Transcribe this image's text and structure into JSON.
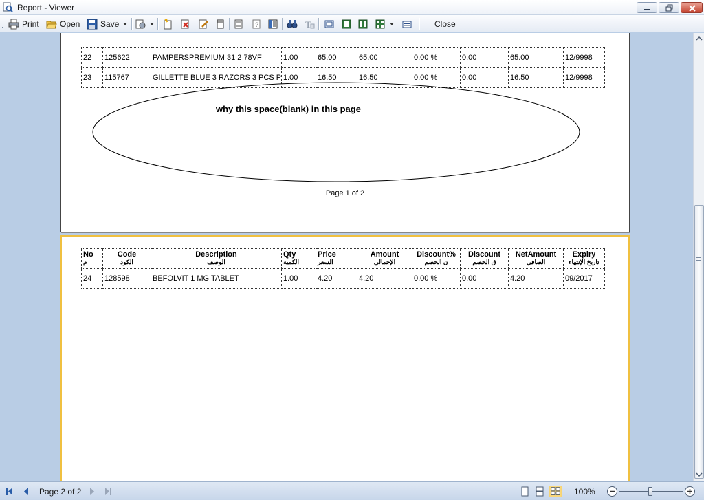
{
  "window": {
    "title": "Report - Viewer"
  },
  "toolbar": {
    "print_label": "Print",
    "open_label": "Open",
    "save_label": "Save",
    "close_label": "Close"
  },
  "columns": [
    {
      "en": "No",
      "ar": "م"
    },
    {
      "en": "Code",
      "ar": "الكود"
    },
    {
      "en": "Description",
      "ar": "الوصف"
    },
    {
      "en": "Qty",
      "ar": "الكمية"
    },
    {
      "en": "Price",
      "ar": "السعر"
    },
    {
      "en": "Amount",
      "ar": "الإجمالي"
    },
    {
      "en": "Discount%",
      "ar": "ن الخصم"
    },
    {
      "en": "Discount",
      "ar": "ق الخصم"
    },
    {
      "en": "NetAmount",
      "ar": "الصافي"
    },
    {
      "en": "Expiry",
      "ar": "تاريخ الإنتهاء"
    }
  ],
  "page1_rows": [
    [
      "22",
      "125622",
      "PAMPERSPREMIUM 31 2  78VF",
      "1.00",
      "65.00",
      "65.00",
      "0.00 %",
      "0.00",
      "65.00",
      "12/9998"
    ],
    [
      "23",
      "115767",
      "GILLETTE BLUE 3 RAZORS 3 PCS P",
      "1.00",
      "16.50",
      "16.50",
      "0.00 %",
      "0.00",
      "16.50",
      "12/9998"
    ]
  ],
  "page2_rows": [
    [
      "24",
      "128598",
      "BEFOLVIT 1 MG TABLET",
      "1.00",
      "4.20",
      "4.20",
      "0.00 %",
      "0.00",
      "4.20",
      "09/2017"
    ]
  ],
  "annotation": {
    "text": "why this space(blank)  in this page"
  },
  "page1_footer": "Page 1 of 2",
  "status": {
    "page_indicator": "Page 2 of 2",
    "zoom": "100%",
    "zoom_level_fraction": 0.5
  },
  "colors": {
    "app_background": "#b9cde5",
    "current_page_border": "#f0c040"
  }
}
